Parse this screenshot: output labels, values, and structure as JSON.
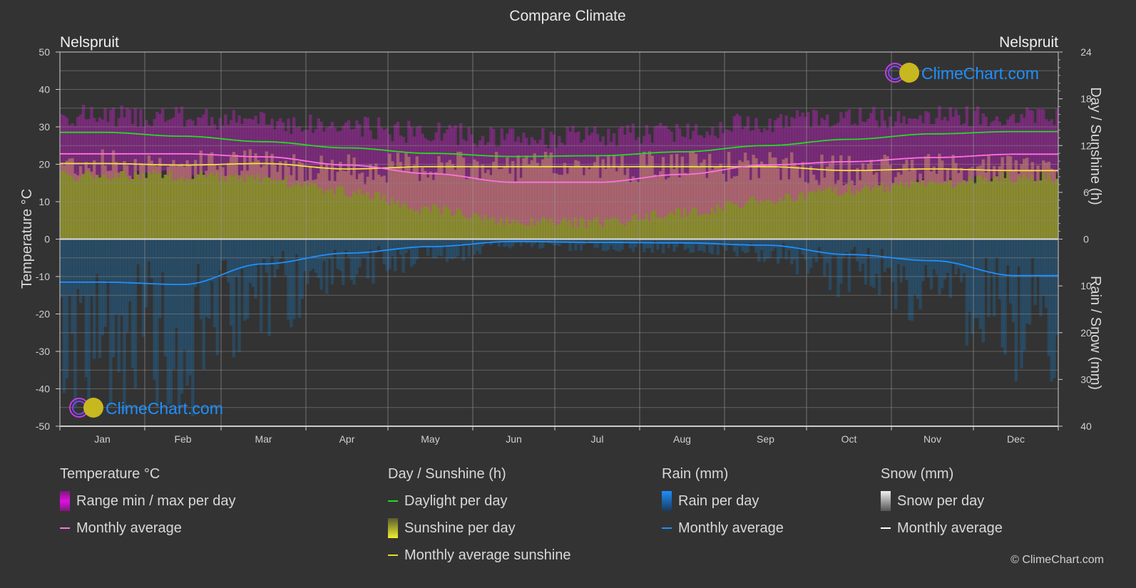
{
  "page": {
    "title": "Compare Climate",
    "location_left": "Nelspruit",
    "location_right": "Nelspruit",
    "watermark": "ClimeChart.com",
    "copyright": "© ClimeChart.com"
  },
  "colors": {
    "background": "#333333",
    "temp_range": "#e020e0",
    "temp_avg": "#ff70e0",
    "daylight": "#22dd22",
    "sunshine_fill": "#9a9a30",
    "sunshine_avg": "#f0e040",
    "rain_fill": "#1a6fb0",
    "rain_avg": "#1e90ff",
    "snow_avg": "#ffffff",
    "brand_blue": "#1e90ff"
  },
  "legend": {
    "temperature": {
      "title": "Temperature °C",
      "items": [
        "Range min / max per day",
        "Monthly average"
      ]
    },
    "sunshine": {
      "title": "Day / Sunshine (h)",
      "items": [
        "Daylight per day",
        "Sunshine per day",
        "Monthly average sunshine"
      ]
    },
    "rain": {
      "title": "Rain (mm)",
      "items": [
        "Rain per day",
        "Monthly average"
      ]
    },
    "snow": {
      "title": "Snow (mm)",
      "items": [
        "Snow per day",
        "Monthly average"
      ]
    }
  },
  "chart_data": {
    "type": "line",
    "title": "Compare Climate",
    "categories": [
      "Jan",
      "Feb",
      "Mar",
      "Apr",
      "May",
      "Jun",
      "Jul",
      "Aug",
      "Sep",
      "Oct",
      "Nov",
      "Dec"
    ],
    "axes": {
      "left": {
        "label": "Temperature °C",
        "range": [
          -50,
          50
        ],
        "ticks": [
          50,
          40,
          30,
          20,
          10,
          0,
          -10,
          -20,
          -30,
          -40,
          -50
        ]
      },
      "right_top": {
        "label": "Day / Sunshine (h)",
        "range": [
          0,
          24
        ],
        "ticks": [
          24,
          18,
          12,
          6,
          0
        ]
      },
      "right_bottom": {
        "label": "Rain / Snow (mm)",
        "range": [
          0,
          40
        ],
        "ticks": [
          0,
          10,
          20,
          30,
          40
        ]
      }
    },
    "grid": true,
    "legend_position": "bottom",
    "series": [
      {
        "name": "Temperature monthly average (°C)",
        "axis": "left",
        "values": [
          22.8,
          22.8,
          22.0,
          19.8,
          17.5,
          15.2,
          15.2,
          17.3,
          19.8,
          20.7,
          21.8,
          22.7
        ]
      },
      {
        "name": "Temperature daily max avg (°C)",
        "axis": "left",
        "values": [
          30.0,
          29.5,
          28.5,
          27.0,
          25.5,
          24.0,
          24.5,
          26.0,
          28.5,
          29.5,
          30.0,
          30.0
        ]
      },
      {
        "name": "Temperature daily min avg (°C)",
        "axis": "left",
        "values": [
          18.5,
          18.5,
          17.5,
          14.0,
          9.5,
          6.0,
          6.0,
          8.5,
          12.0,
          14.5,
          16.5,
          18.0
        ]
      },
      {
        "name": "Daylight per day (h)",
        "axis": "right_top",
        "values": [
          13.7,
          13.2,
          12.5,
          11.7,
          11.0,
          10.6,
          10.7,
          11.2,
          12.0,
          12.8,
          13.5,
          13.8
        ]
      },
      {
        "name": "Monthly average sunshine (h)",
        "axis": "right_top",
        "values": [
          9.7,
          9.5,
          9.7,
          9.0,
          9.3,
          9.3,
          9.3,
          9.3,
          9.3,
          8.8,
          9.0,
          8.8
        ]
      },
      {
        "name": "Rain monthly average (mm)",
        "axis": "right_bottom",
        "values": [
          9.2,
          9.7,
          5.3,
          3.0,
          1.6,
          0.5,
          0.7,
          0.8,
          1.3,
          3.3,
          4.6,
          7.8
        ]
      },
      {
        "name": "Snow monthly average (mm)",
        "axis": "right_bottom",
        "values": [
          0,
          0,
          0,
          0,
          0,
          0,
          0,
          0,
          0,
          0,
          0,
          0
        ]
      }
    ]
  }
}
